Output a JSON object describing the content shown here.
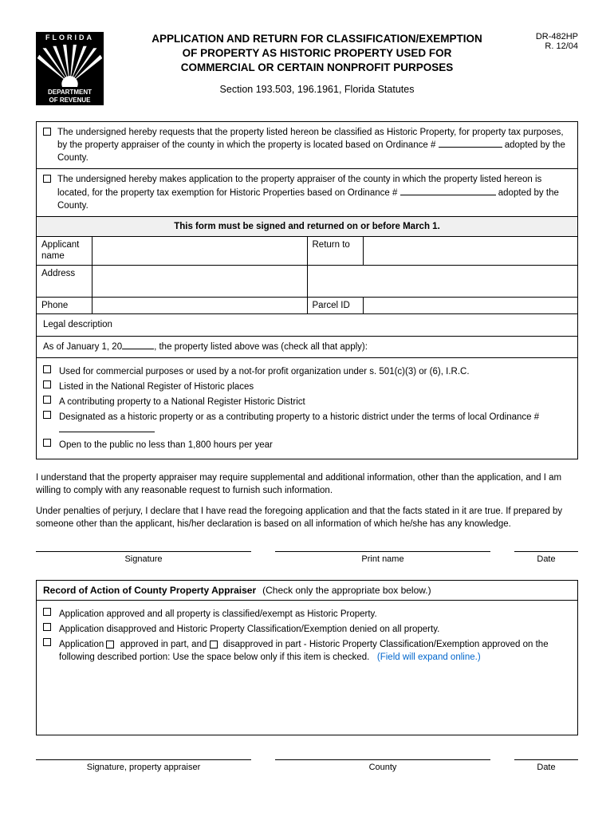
{
  "form_id": "DR-482HP",
  "revision": "R. 12/04",
  "logo": {
    "state": "FLORIDA",
    "dept1": "DEPARTMENT",
    "dept2": "OF REVENUE"
  },
  "title_l1": "APPLICATION AND RETURN FOR CLASSIFICATION/EXEMPTION",
  "title_l2": "OF PROPERTY AS HISTORIC PROPERTY USED FOR",
  "title_l3": "COMMERCIAL OR CERTAIN NONPROFIT PURPOSES",
  "subtitle": "Section 193.503, 196.1961, Florida Statutes",
  "request1_a": "The undersigned hereby requests that the property listed hereon be classified as Historic Property, for property tax purposes, by the property appraiser of the county in which the property is located based on Ordinance #",
  "request1_b": "adopted by the County.",
  "request2_a": "The undersigned hereby makes application to the property appraiser of the county in which the property listed hereon is located, for the property tax exemption for Historic Properties based on Ordinance #",
  "request2_b": "adopted by the County.",
  "notice": "This form must be signed and returned on or before March 1.",
  "labels": {
    "applicant": "Applicant name",
    "return_to": "Return to",
    "address": "Address",
    "phone": "Phone",
    "parcel_id": "Parcel ID",
    "legal_desc": "Legal description"
  },
  "asof_a": "As of January 1, 20",
  "asof_b": ", the property listed above was (check all that apply):",
  "checks": [
    "Used for commercial purposes or used by a not-for profit organization under s. 501(c)(3) or (6), I.R.C.",
    "Listed in the National Register of Historic places",
    "A contributing property to a National Register Historic District",
    "Designated as a historic property or as a contributing property to a historic district under the terms of local Ordinance #",
    "Open to the public no less than 1,800 hours per year"
  ],
  "decl1": "I understand that the property appraiser may require supplemental and additional information, other than the application, and I am willing to comply with any reasonable request to furnish such information.",
  "decl2": "Under penalties of perjury, I declare that I have read the foregoing application and that the facts stated in it are true. If prepared by someone other than the applicant, his/her declaration is based on all information of which he/she has any knowledge.",
  "sig_labels": {
    "sig": "Signature",
    "print": "Print name",
    "date": "Date"
  },
  "record": {
    "title": "Record of Action of County Property Appraiser",
    "hint": "(Check only the appropriate box below.)",
    "opt1": "Application approved and all property is classified/exempt as Historic Property.",
    "opt2": "Application disapproved and Historic Property Classification/Exemption denied on all property.",
    "opt3_a": "Application",
    "opt3_b": "approved in part, and",
    "opt3_c": "disapproved in part - Historic Property Classification/Exemption approved on the following described portion:  Use the space below only if this item is checked.",
    "opt3_hint": "(Field will expand online.)"
  },
  "sig2_labels": {
    "sig": "Signature, property appraiser",
    "county": "County",
    "date": "Date"
  }
}
